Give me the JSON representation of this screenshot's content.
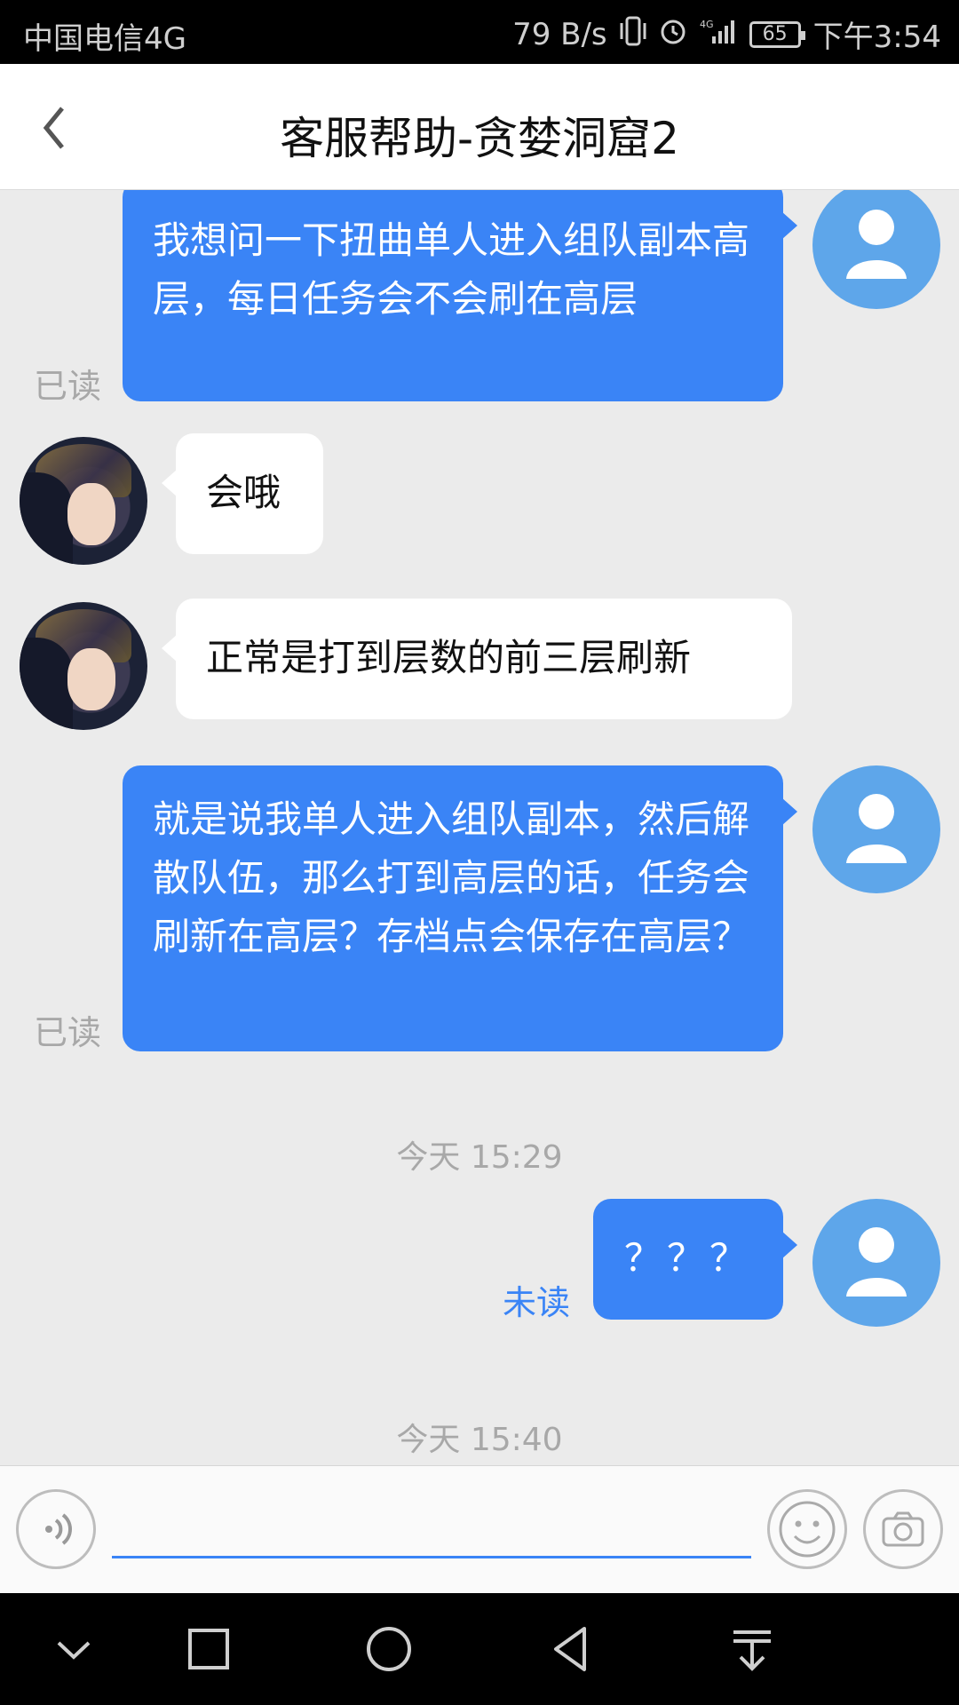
{
  "status_bar": {
    "carrier": "中国电信4G",
    "net_speed": "79 B/s",
    "network_type": "4G",
    "battery": "65",
    "time": "下午3:54",
    "icons": [
      "vibrate-icon",
      "alarm-icon",
      "signal-icon",
      "battery-icon"
    ]
  },
  "header": {
    "back_icon": "back-chevron-icon",
    "title": "客服帮助-贪婪洞窟2"
  },
  "messages": [
    {
      "direction": "out",
      "text": "我想问一下扭曲单人进入组队副本高层，每日任务会不会刷在高层",
      "status": "已读"
    },
    {
      "direction": "in",
      "text": "会哦"
    },
    {
      "direction": "in",
      "text": "正常是打到层数的前三层刷新"
    },
    {
      "direction": "out",
      "text": "就是说我单人进入组队副本，然后解散队伍，那么打到高层的话，任务会刷新在高层？存档点会保存在高层？",
      "status": "已读"
    },
    {
      "type": "timestamp",
      "text": "今天 15:29"
    },
    {
      "direction": "out",
      "text": "？？？",
      "status": "未读"
    },
    {
      "type": "timestamp",
      "text": "今天 15:40"
    }
  ],
  "input_bar": {
    "voice_icon": "voice-icon",
    "text_value": "",
    "emoji_icon": "smiley-icon",
    "camera_icon": "camera-icon"
  },
  "nav_bar": {
    "icons": [
      "chevron-down-icon",
      "recents-square-icon",
      "home-circle-icon",
      "back-triangle-icon",
      "notification-pulldown-icon"
    ]
  },
  "colors": {
    "accent": "#3a84f6",
    "avatar_user": "#5ea6ea",
    "chat_background": "#ebebeb"
  }
}
